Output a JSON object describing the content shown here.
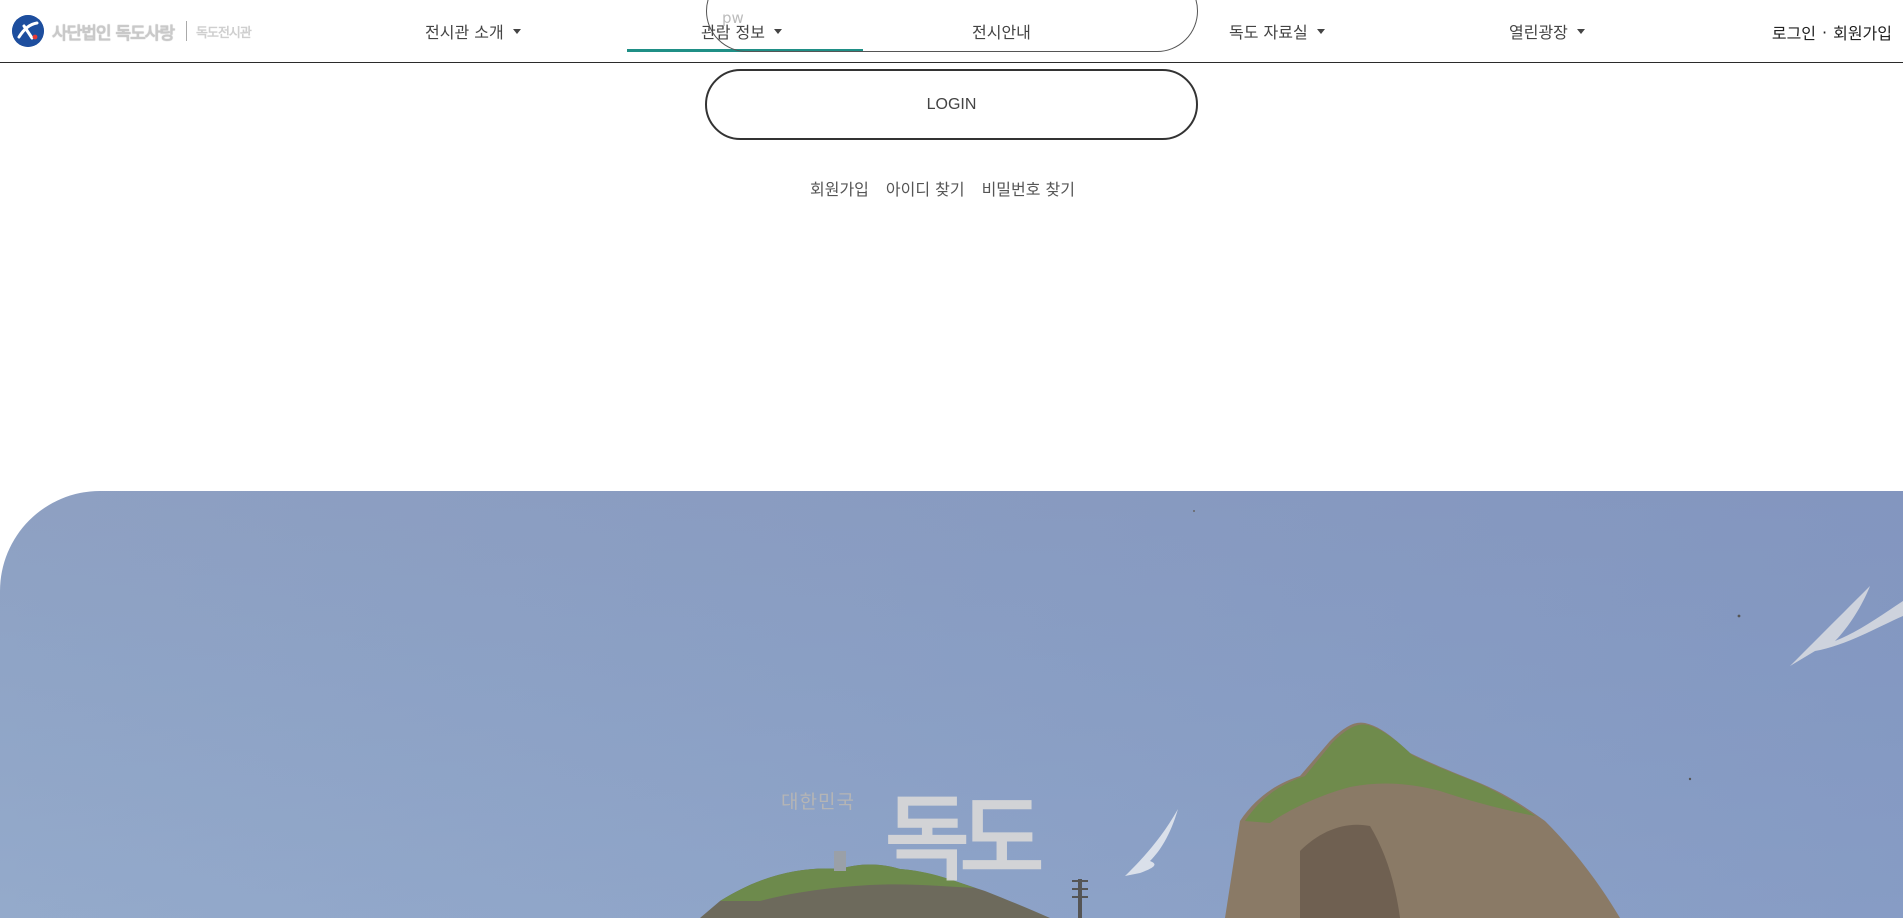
{
  "header": {
    "logo_text": "사단법인 독도사랑",
    "logo_sub": "독도전시관",
    "nav": [
      {
        "label": "전시관 소개",
        "has_dropdown": true
      },
      {
        "label": "관람 정보",
        "has_dropdown": true
      },
      {
        "label": "전시안내",
        "has_dropdown": false
      },
      {
        "label": "독도 자료실",
        "has_dropdown": true
      },
      {
        "label": "열린광장",
        "has_dropdown": true
      }
    ],
    "user_links": {
      "login": "로그인",
      "separator": "·",
      "signup": "회원가입"
    }
  },
  "login_form": {
    "pw_placeholder": "pw",
    "login_button": "LOGIN",
    "links": [
      "회원가입",
      "아이디 찾기",
      "비밀번호 찾기"
    ]
  },
  "hero": {
    "subtitle": "대한민국",
    "title": "독도"
  },
  "colors": {
    "accent": "#1f8f86",
    "header_border": "#2b2b2b",
    "logo_blue": "#1d4e9e"
  }
}
